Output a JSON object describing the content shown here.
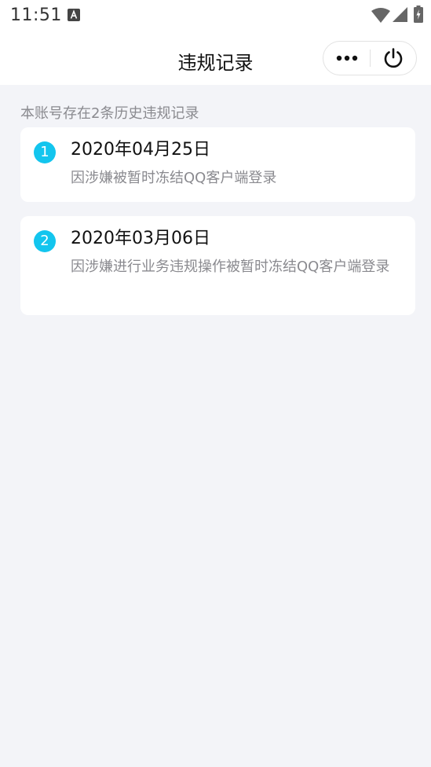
{
  "status_bar": {
    "time": "11:51"
  },
  "nav": {
    "title": "违规记录"
  },
  "summary": "本账号存在2条历史违规记录",
  "records": [
    {
      "index": "1",
      "date": "2020年04月25日",
      "description": "因涉嫌被暂时冻结QQ客户端登录"
    },
    {
      "index": "2",
      "date": "2020年03月06日",
      "description": "因涉嫌进行业务违规操作被暂时冻结QQ客户端登录"
    }
  ],
  "colors": {
    "accent": "#13c5ee",
    "background": "#f3f4f8",
    "card": "#ffffff",
    "secondary_text": "#8a8a8f"
  },
  "icons": {
    "status": [
      "a-notification-icon",
      "wifi-icon",
      "signal-icon",
      "battery-icon"
    ],
    "capsule": [
      "more-icon",
      "power-icon"
    ]
  }
}
